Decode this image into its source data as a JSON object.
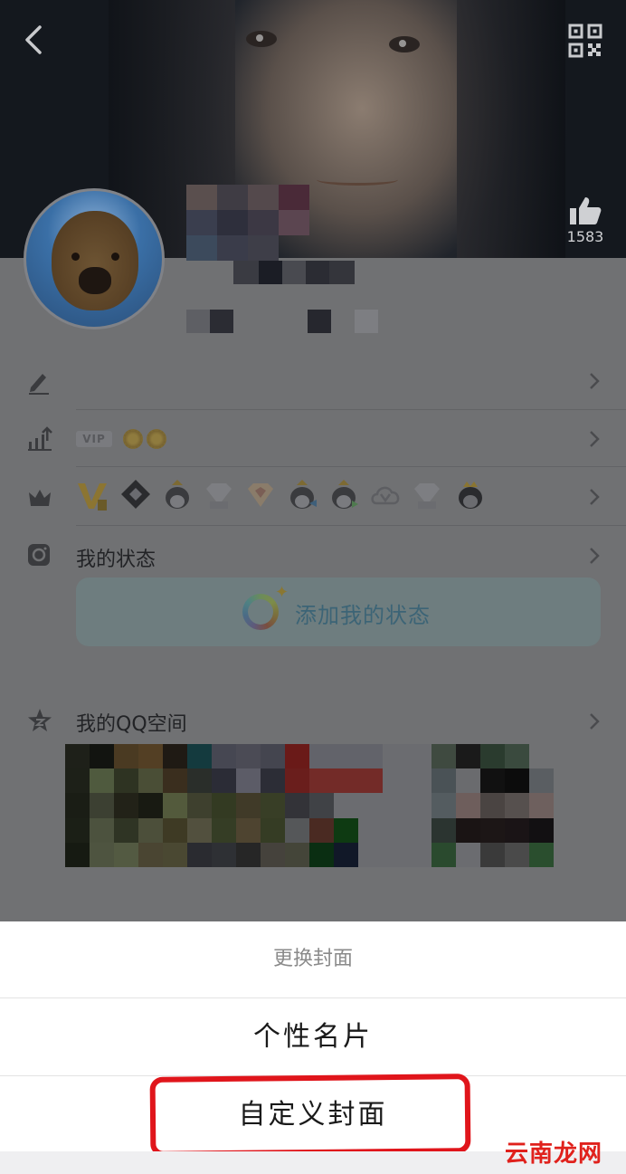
{
  "cover": {
    "like_count": "1583",
    "icons": {
      "back": "chevron-left-icon",
      "qr": "qr-code-icon",
      "like": "thumbs-up-icon"
    }
  },
  "profile": {
    "rows": [
      {
        "id": "edit",
        "icon": "pencil-icon"
      },
      {
        "id": "level",
        "icon": "level-chart-icon",
        "vip_label": "VIP"
      },
      {
        "id": "privileges",
        "icon": "crown-icon"
      },
      {
        "id": "status",
        "icon": "camera-icon",
        "label": "我的状态",
        "card_text": "添加我的状态"
      },
      {
        "id": "qzone",
        "icon": "qzone-star-icon",
        "label": "我的QQ空间"
      }
    ]
  },
  "sheet": {
    "title": "更换封面",
    "options": [
      "个性名片",
      "自定义封面"
    ]
  },
  "watermark": "云南龙网",
  "colors": {
    "highlight": "#e0151b",
    "watermark": "#e0211c",
    "status_text": "#3c6476"
  }
}
